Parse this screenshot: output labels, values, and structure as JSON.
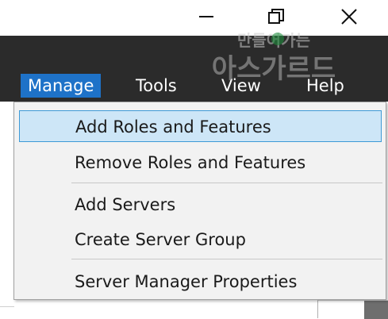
{
  "window_controls": {
    "minimize_icon": "minimize-icon",
    "restore_icon": "restore-icon",
    "close_icon": "close-icon"
  },
  "menu_bar": {
    "items": [
      {
        "label": "Manage",
        "active": true
      },
      {
        "label": "Tools",
        "active": false
      },
      {
        "label": "View",
        "active": false
      },
      {
        "label": "Help",
        "active": false
      }
    ]
  },
  "manage_menu": {
    "items": [
      {
        "label": "Add Roles and Features",
        "highlighted": true
      },
      {
        "label": "Remove Roles and Features",
        "highlighted": false
      },
      {
        "label": "Add Servers",
        "highlighted": false
      },
      {
        "label": "Create Server Group",
        "highlighted": false
      },
      {
        "label": "Server Manager Properties",
        "highlighted": false
      }
    ]
  },
  "watermark": {
    "line1": "만들어가는",
    "line2": "아스가르드"
  },
  "colors": {
    "menu_bar_bg": "#2b2b2b",
    "menu_active_bg": "#1e72c8",
    "highlight_bg": "#cde6f7",
    "highlight_border": "#3d9ad6",
    "dropdown_bg": "#f2f2f2"
  }
}
